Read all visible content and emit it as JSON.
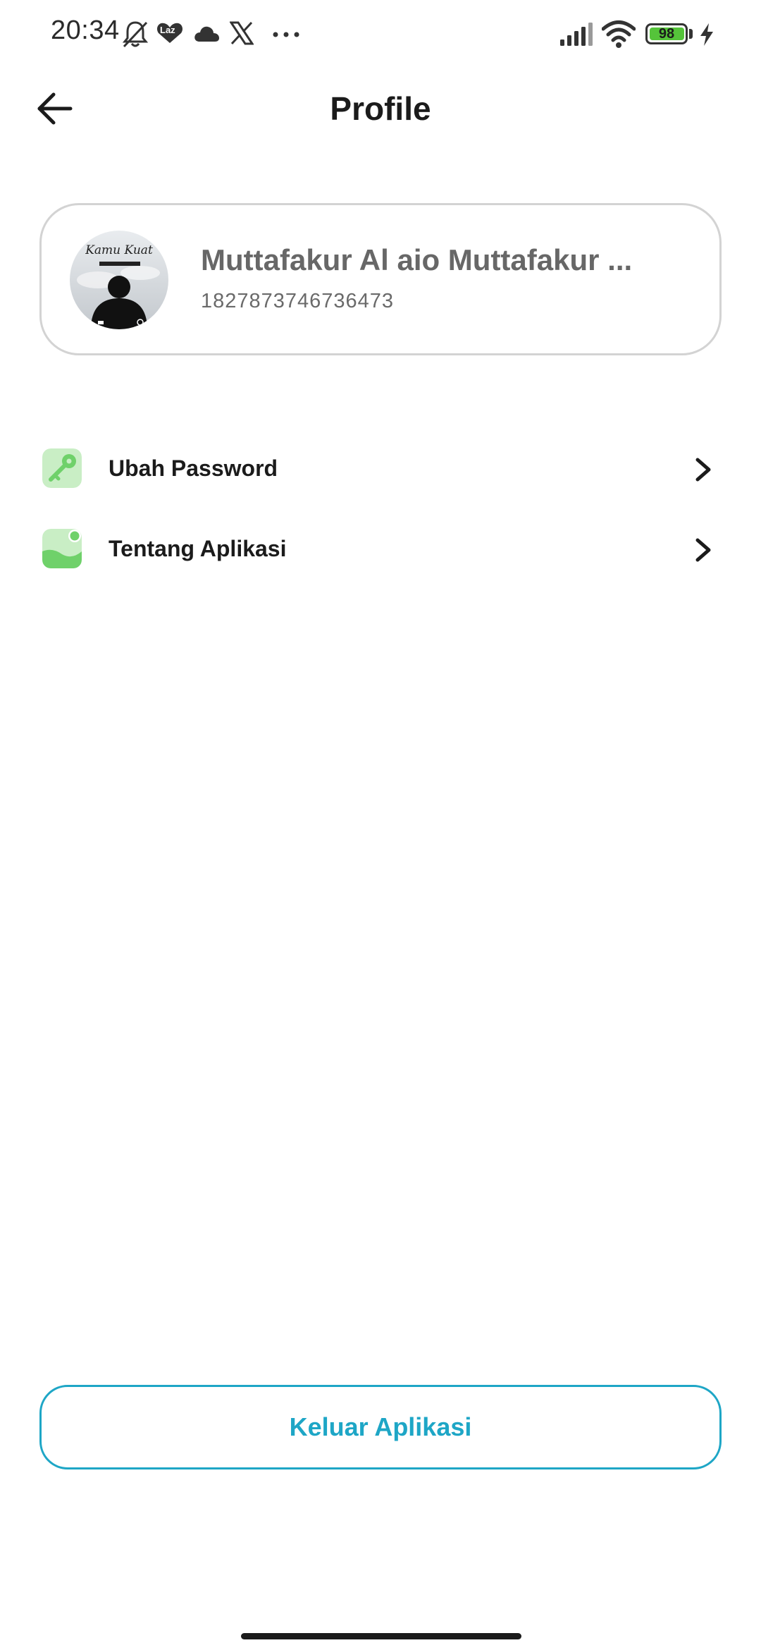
{
  "status_bar": {
    "time": "20:34",
    "app_badge": "Laz",
    "battery_level": "98",
    "icons": [
      "bell-muted-icon",
      "lazada-icon",
      "cloud-icon",
      "x-logo-icon",
      "more-dots-icon",
      "signal-icon",
      "wifi-icon",
      "battery-icon",
      "charging-bolt-icon"
    ]
  },
  "header": {
    "title": "Profile",
    "back_icon": "arrow-left-icon"
  },
  "profile": {
    "name": "Muttafakur Al aio Muttafakur ...",
    "id": "1827873746736473",
    "avatar_caption": "Kamu Kuat"
  },
  "menu": [
    {
      "label": "Ubah Password",
      "icon": "key-icon"
    },
    {
      "label": "Tentang Aplikasi",
      "icon": "app-info-icon"
    }
  ],
  "logout": {
    "label": "Keluar Aplikasi"
  },
  "colors": {
    "accent": "#1ea6c6",
    "icon_green": "#6fd16a",
    "icon_green_light": "#c9eec5",
    "battery_green": "#55c43a"
  }
}
